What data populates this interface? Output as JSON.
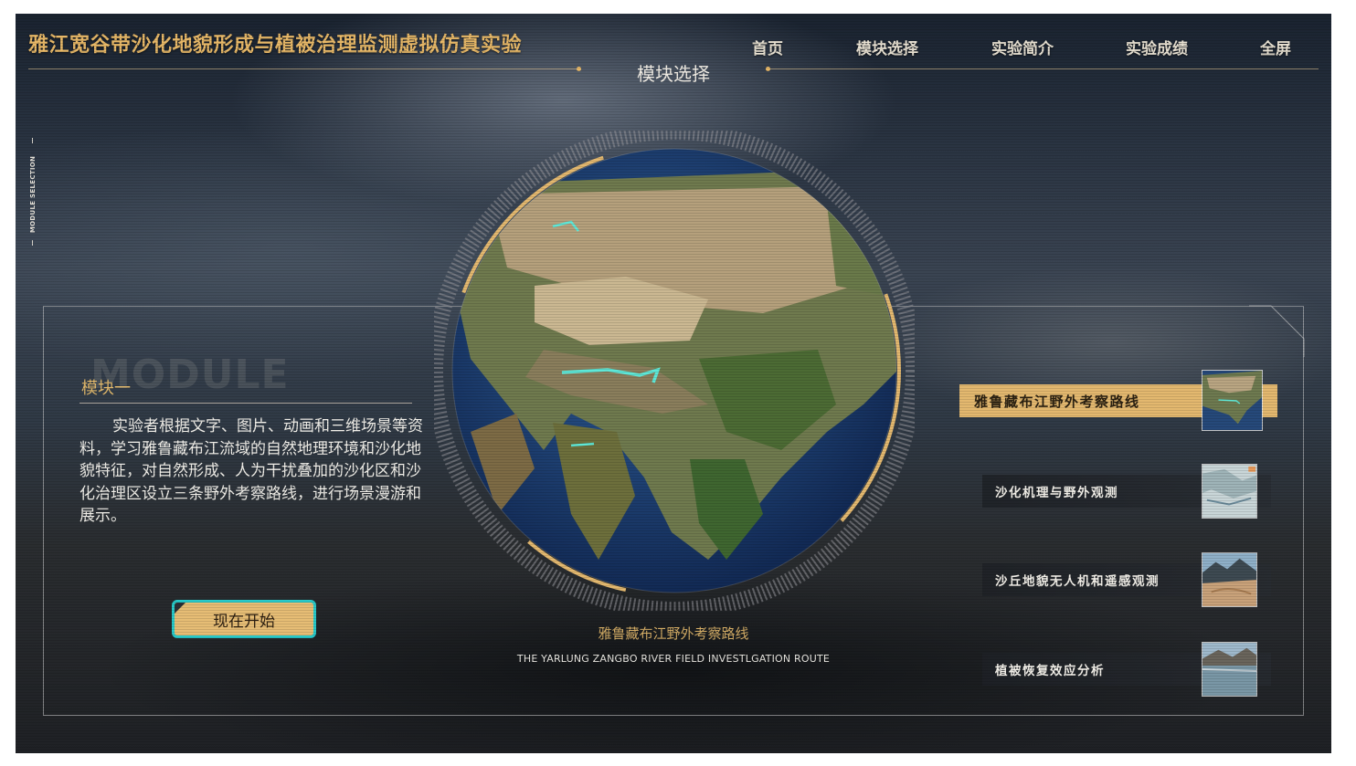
{
  "app": {
    "title": "雅江宽谷带沙化地貌形成与植被治理监测虚拟仿真实验"
  },
  "nav": {
    "items": [
      {
        "label": "首页"
      },
      {
        "label": "模块选择"
      },
      {
        "label": "实验简介"
      },
      {
        "label": "实验成绩"
      },
      {
        "label": "全屏"
      }
    ]
  },
  "section": {
    "title": "模块选择",
    "side_tag": "MODULE SELECTION"
  },
  "module": {
    "watermark": "MODULE",
    "label": "模块一",
    "description": "实验者根据文字、图片、动画和三维场景等资料，学习雅鲁藏布江流域的自然地理环境和沙化地貌特征，对自然形成、人为干扰叠加的沙化区和沙化治理区设立三条野外考察路线，进行场景漫游和展示。",
    "start_button": "现在开始"
  },
  "globe": {
    "caption": "雅鲁藏布江野外考察路线",
    "caption_en": "THE YARLUNG ZANGBO RIVER FIELD INVESTLGATION ROUTE"
  },
  "routes": [
    {
      "label": "雅鲁藏布江野外考察路线",
      "active": true,
      "thumb_icon": "map-thumbnail"
    },
    {
      "label": "沙化机理与野外观测",
      "active": false,
      "thumb_icon": "terrain-thumbnail"
    },
    {
      "label": "沙丘地貌无人机和遥感观测",
      "active": false,
      "thumb_icon": "dune-thumbnail"
    },
    {
      "label": "植被恢复效应分析",
      "active": false,
      "thumb_icon": "lake-thumbnail"
    }
  ],
  "colors": {
    "accent_gold": "#e3b86f",
    "title_gold": "#e7b868",
    "button_border": "#28c9c9",
    "route_line": "#5ee8d8"
  }
}
